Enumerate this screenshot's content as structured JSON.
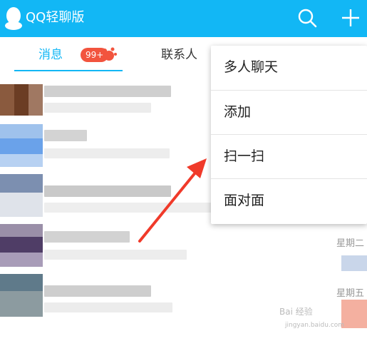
{
  "header": {
    "app_title": "QQ轻聊版",
    "logo_icon": "qq-penguin-icon",
    "search_icon": "search-icon",
    "add_icon": "plus-icon",
    "background": "#12b7f5"
  },
  "tabs": {
    "messages_label": "消息",
    "messages_badge": "99+",
    "contacts_label": "联系人",
    "active_color": "#12b7f5"
  },
  "conversation_list": {
    "rows": [
      {
        "time": ""
      },
      {
        "time": ""
      },
      {
        "time": ""
      },
      {
        "time": "星期二"
      },
      {
        "time": "星期五"
      }
    ]
  },
  "add_menu": {
    "items": [
      {
        "label": "多人聊天"
      },
      {
        "label": "添加"
      },
      {
        "label": "扫一扫"
      },
      {
        "label": "面对面"
      }
    ]
  },
  "annotation": {
    "arrow_color": "#f03a2a"
  },
  "watermark": {
    "text": "Bai 经验",
    "url": "jingyan.baidu.com"
  }
}
